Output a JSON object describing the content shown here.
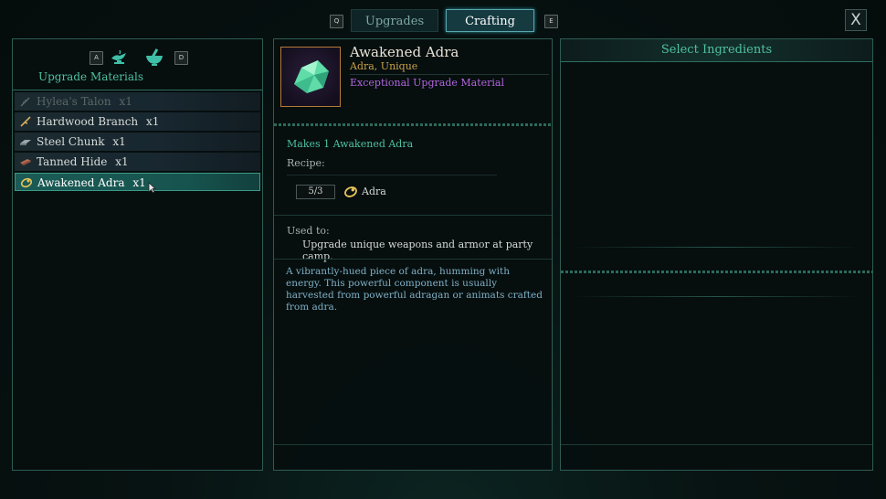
{
  "top_bar": {
    "left_key": "Q",
    "right_key": "E",
    "tabs": [
      {
        "label": "Upgrades",
        "active": false
      },
      {
        "label": "Crafting",
        "active": true
      }
    ],
    "close_label": "X"
  },
  "left_panel": {
    "prev_key": "A",
    "next_key": "D",
    "title": "Upgrade Materials",
    "categories": [
      "lamp-icon",
      "mortar-icon"
    ],
    "items": [
      {
        "name": "Hylea's Talon",
        "qty": "x1",
        "icon": "feather-icon",
        "available": false
      },
      {
        "name": "Hardwood Branch",
        "qty": "x1",
        "icon": "branch-icon",
        "available": true
      },
      {
        "name": "Steel Chunk",
        "qty": "x1",
        "icon": "ingot-icon",
        "available": true
      },
      {
        "name": "Tanned Hide",
        "qty": "x1",
        "icon": "hide-icon",
        "available": true
      },
      {
        "name": "Awakened Adra",
        "qty": "x1",
        "icon": "adra-icon",
        "available": true,
        "selected": true
      }
    ]
  },
  "detail": {
    "name": "Awakened Adra",
    "subtitle": "Adra, Unique",
    "category": "Exceptional Upgrade Material",
    "makes": "Makes 1 Awakened Adra",
    "recipe_label": "Recipe:",
    "recipe": [
      {
        "have_need": "5/3",
        "ingredient": "Adra",
        "icon": "adra-icon"
      }
    ],
    "used_to_label": "Used to:",
    "used_to": "Upgrade unique weapons and armor at party camp.",
    "description": "A vibrantly-hued piece of adra, humming with energy. This powerful component is usually harvested from powerful adragan or animats crafted from adra."
  },
  "right_panel": {
    "title": "Select Ingredients"
  },
  "colors": {
    "accent_teal": "#3c9a87",
    "item_name": "#e8e3d8",
    "subtitle_gold": "#c9a24a",
    "category_purple": "#b266e0",
    "makes_teal": "#4fc0a0"
  }
}
